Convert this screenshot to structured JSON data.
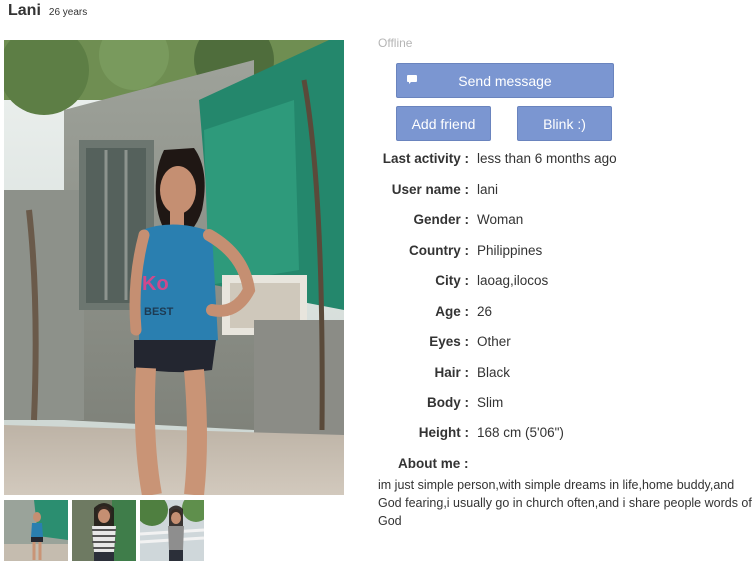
{
  "profile": {
    "name": "Lani",
    "age_text": "26 years",
    "status": "Offline"
  },
  "buttons": {
    "send": "Send message",
    "add_friend": "Add friend",
    "blink": "Blink :)"
  },
  "details": [
    {
      "label": "Last activity :",
      "value": "less than 6 months ago"
    },
    {
      "label": "User name :",
      "value": "lani"
    },
    {
      "label": "Gender :",
      "value": "Woman"
    },
    {
      "label": "Country :",
      "value": "Philippines"
    },
    {
      "label": "City :",
      "value": "laoag,ilocos"
    },
    {
      "label": "Age :",
      "value": "26"
    },
    {
      "label": "Eyes :",
      "value": "Other"
    },
    {
      "label": "Hair :",
      "value": "Black"
    },
    {
      "label": "Body :",
      "value": "Slim"
    },
    {
      "label": "Height :",
      "value": "168 cm (5'06\")"
    }
  ],
  "about": {
    "label": "About me :",
    "text": "im just simple person,with simple dreams in life,home buddy,and God fearing,i usually go in church often,and i share people words of God"
  },
  "photo": {
    "shirt_text": "Ko\nBEST"
  },
  "colors": {
    "button": "#7b96d1",
    "offline": "#b5b5b5"
  }
}
